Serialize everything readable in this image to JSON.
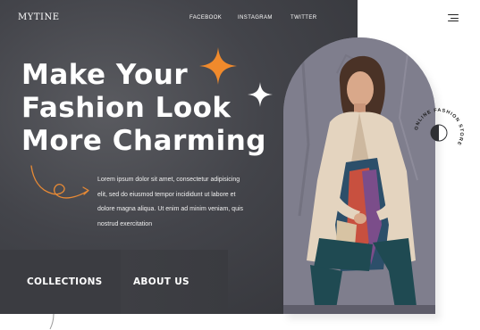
{
  "brand": {
    "logo": "MYTINE"
  },
  "nav": {
    "links": [
      "FACEBOOK",
      "INSTAGRAM",
      "TWITTER"
    ]
  },
  "hero": {
    "headline_lines": [
      "Make Your",
      "Fashion Look",
      "More Charming"
    ],
    "description_lines": [
      "Lorem ipsum dolor sit amet, consectetur adipisicing",
      "elit, sed do eiusmod tempor incididunt ut labore et",
      "dolore magna aliqua. Ut enim ad minim veniam, quis",
      "nostrud exercitation"
    ]
  },
  "cards": {
    "collections": "COLLECTIONS",
    "about": "ABOUT US"
  },
  "badge": {
    "text": "ONLINE FASHION STORE"
  },
  "colors": {
    "accent": "#f08a2c",
    "dark": "#3d3e43",
    "white": "#ffffff"
  },
  "icons": [
    "menu-icon",
    "orange-star-icon",
    "white-star-icon",
    "swirl-arrow-icon",
    "half-circle-icon"
  ]
}
